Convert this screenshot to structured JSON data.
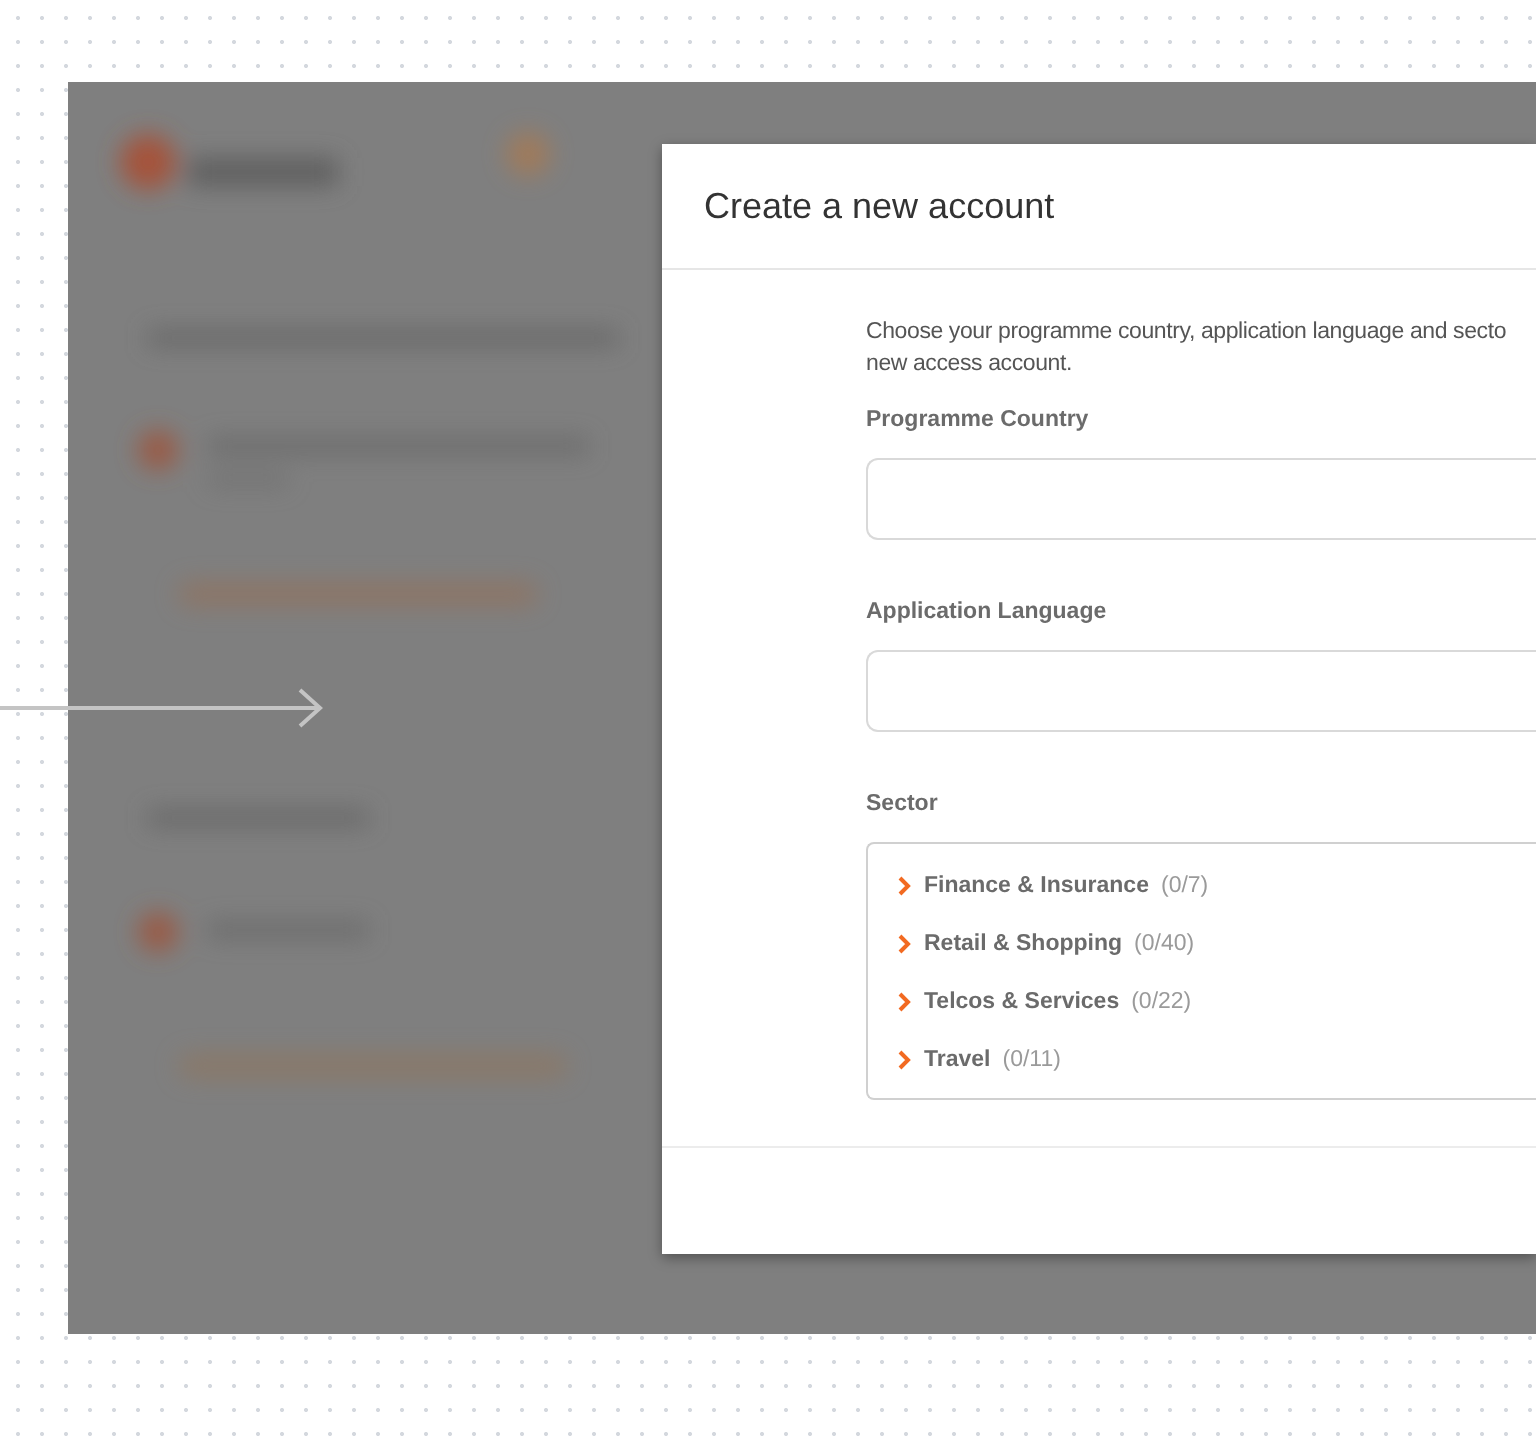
{
  "dialog": {
    "title": "Create a new account",
    "intro_lines": [
      "Choose your programme country, application language and secto",
      "new access account."
    ],
    "fields": [
      {
        "label": "Programme Country"
      },
      {
        "label": "Application Language"
      }
    ],
    "sector": {
      "label": "Sector",
      "items": [
        {
          "name": "Finance & Insurance",
          "count": "(0/7)",
          "expanded": false
        },
        {
          "name": "Retail & Shopping",
          "count": "(0/40)",
          "expanded": false
        },
        {
          "name": "Telcos & Services",
          "count": "(0/22)",
          "expanded": false
        },
        {
          "name": "Travel",
          "count": "(0/11)",
          "expanded": false
        }
      ]
    }
  }
}
